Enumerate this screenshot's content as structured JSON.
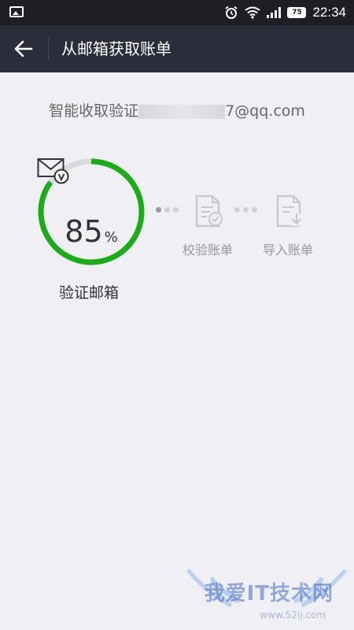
{
  "status_bar": {
    "time": "22:34",
    "battery": "75",
    "icons": [
      "image-icon",
      "alarm-icon",
      "wifi-icon",
      "signal-icon",
      "battery-icon"
    ]
  },
  "toolbar": {
    "title": "从邮箱获取账单",
    "back_icon": "arrow-left-icon"
  },
  "email_notice": {
    "prefix": "智能收取验证",
    "suffix": "7@qq.com"
  },
  "progress": {
    "value": 0.85,
    "number": "85",
    "unit": "%",
    "color": "#1aad19",
    "track_color": "#d9dadc"
  },
  "steps": [
    {
      "label": "验证邮箱",
      "icon": "mail-check-icon",
      "active": true
    },
    {
      "label": "校验账单",
      "icon": "document-check-icon",
      "active": false
    },
    {
      "label": "导入账单",
      "icon": "document-import-icon",
      "active": false
    }
  ],
  "watermark": {
    "text": "我爱IT技术网",
    "sub": "www.52ij.com"
  }
}
